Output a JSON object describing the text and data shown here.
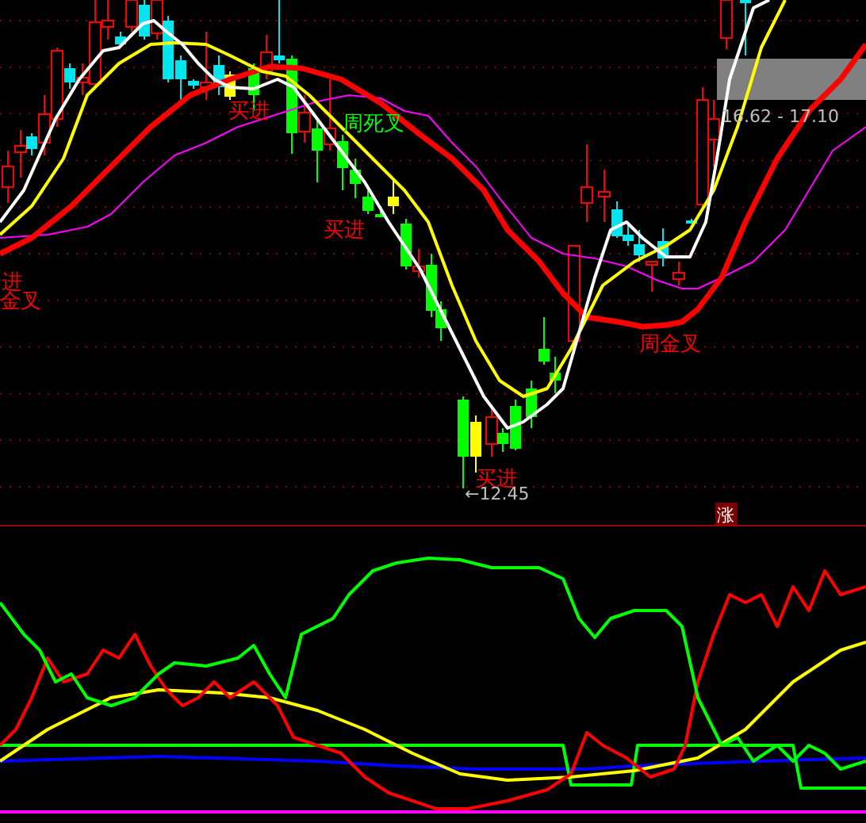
{
  "price_panel": {
    "signals": [
      {
        "text": "进",
        "kind": "buy"
      },
      {
        "text": "金叉",
        "kind": "buy"
      },
      {
        "text": "买进",
        "kind": "buy"
      },
      {
        "text": "周死叉",
        "kind": "sell"
      },
      {
        "text": "买进",
        "kind": "buy"
      },
      {
        "text": "买进",
        "kind": "buy"
      },
      {
        "text": "周金叉",
        "kind": "buy"
      }
    ],
    "range_label": "16.62 - 17.10",
    "low_label": "←12.45"
  },
  "indicator_panel": {
    "badge": "涨"
  }
}
